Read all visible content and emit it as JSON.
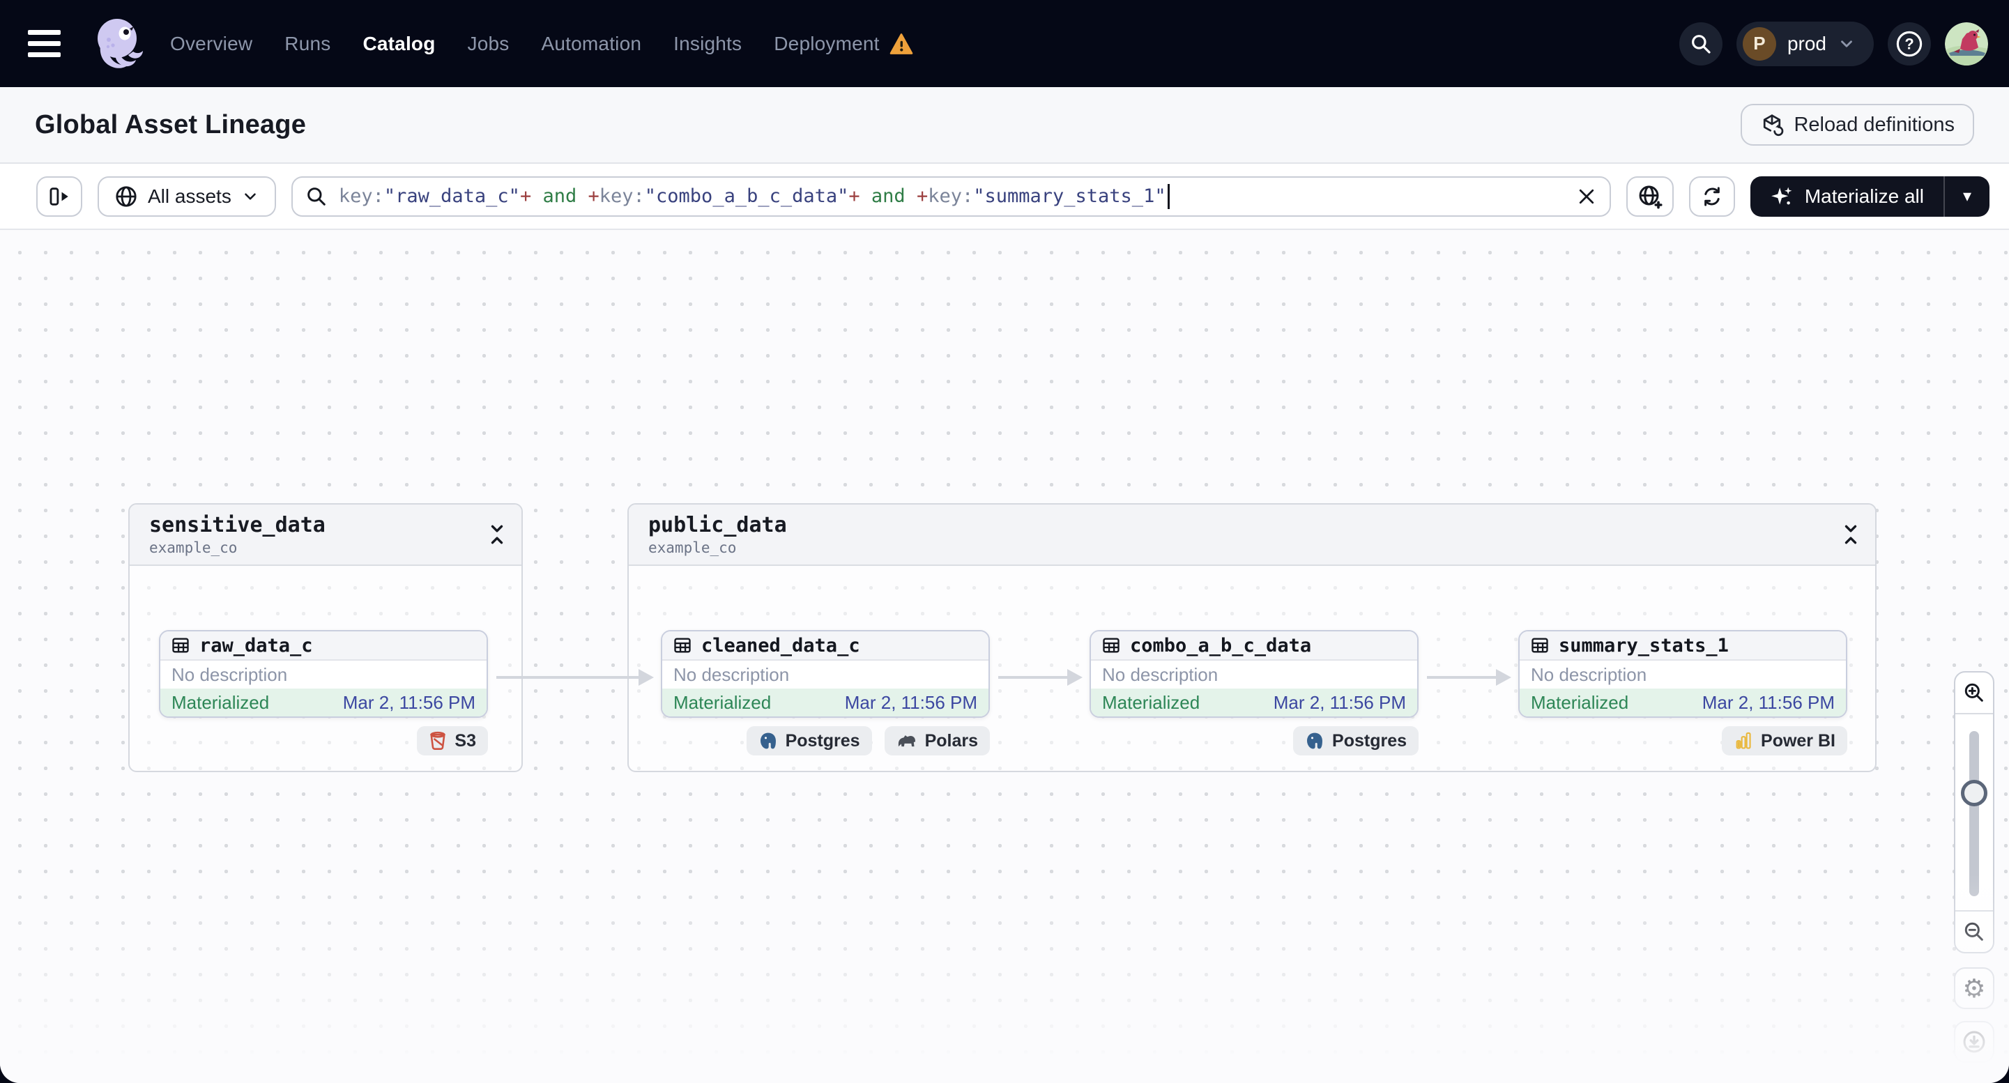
{
  "nav": {
    "items": [
      {
        "label": "Overview",
        "active": false
      },
      {
        "label": "Runs",
        "active": false
      },
      {
        "label": "Catalog",
        "active": true
      },
      {
        "label": "Jobs",
        "active": false
      },
      {
        "label": "Automation",
        "active": false
      },
      {
        "label": "Insights",
        "active": false
      },
      {
        "label": "Deployment",
        "active": false,
        "warning": true
      }
    ],
    "environment": {
      "label": "prod",
      "avatar_letter": "P"
    }
  },
  "header": {
    "title": "Global Asset Lineage",
    "reload_label": "Reload definitions"
  },
  "toolbar": {
    "scope_label": "All assets",
    "materialize_label": "Materialize all",
    "query": {
      "parts": [
        {
          "text": "key:",
          "type": "key"
        },
        {
          "text": "\"raw_data_c\"",
          "type": "value"
        },
        {
          "text": "+",
          "type": "plus"
        },
        {
          "text": " and ",
          "type": "and"
        },
        {
          "text": "+",
          "type": "plus"
        },
        {
          "text": "key:",
          "type": "key"
        },
        {
          "text": "\"combo_a_b_c_data\"",
          "type": "value"
        },
        {
          "text": "+",
          "type": "plus"
        },
        {
          "text": " and ",
          "type": "and"
        },
        {
          "text": "+",
          "type": "plus"
        },
        {
          "text": "key:",
          "type": "key"
        },
        {
          "text": "\"summary_stats_1\"",
          "type": "value"
        }
      ]
    }
  },
  "graph": {
    "groups": [
      {
        "name": "sensitive_data",
        "repo": "example_co",
        "assets": [
          {
            "name": "raw_data_c",
            "description": "No description",
            "status": "Materialized",
            "timestamp": "Mar 2, 11:56 PM",
            "tags": [
              {
                "label": "S3",
                "icon": "s3-icon"
              }
            ]
          }
        ]
      },
      {
        "name": "public_data",
        "repo": "example_co",
        "assets": [
          {
            "name": "cleaned_data_c",
            "description": "No description",
            "status": "Materialized",
            "timestamp": "Mar 2, 11:56 PM",
            "tags": [
              {
                "label": "Postgres",
                "icon": "postgres-icon"
              },
              {
                "label": "Polars",
                "icon": "polars-icon"
              }
            ]
          },
          {
            "name": "combo_a_b_c_data",
            "description": "No description",
            "status": "Materialized",
            "timestamp": "Mar 2, 11:56 PM",
            "tags": [
              {
                "label": "Postgres",
                "icon": "postgres-icon"
              }
            ]
          },
          {
            "name": "summary_stats_1",
            "description": "No description",
            "status": "Materialized",
            "timestamp": "Mar 2, 11:56 PM",
            "tags": [
              {
                "label": "Power BI",
                "icon": "powerbi-icon"
              }
            ]
          }
        ]
      }
    ]
  },
  "icons": {
    "materialize_caret": "▾",
    "gear": "⚙"
  },
  "colors": {
    "topbar_bg": "#050816",
    "warning_orange": "#efa13b",
    "materialized_green": "#2d8656",
    "timestamp_indigo": "#3c47a1",
    "query_key_gray": "#7b8499",
    "query_value_indigo": "#39427e",
    "query_plus_red": "#9c3f3f",
    "query_and_green": "#2f7d46"
  }
}
